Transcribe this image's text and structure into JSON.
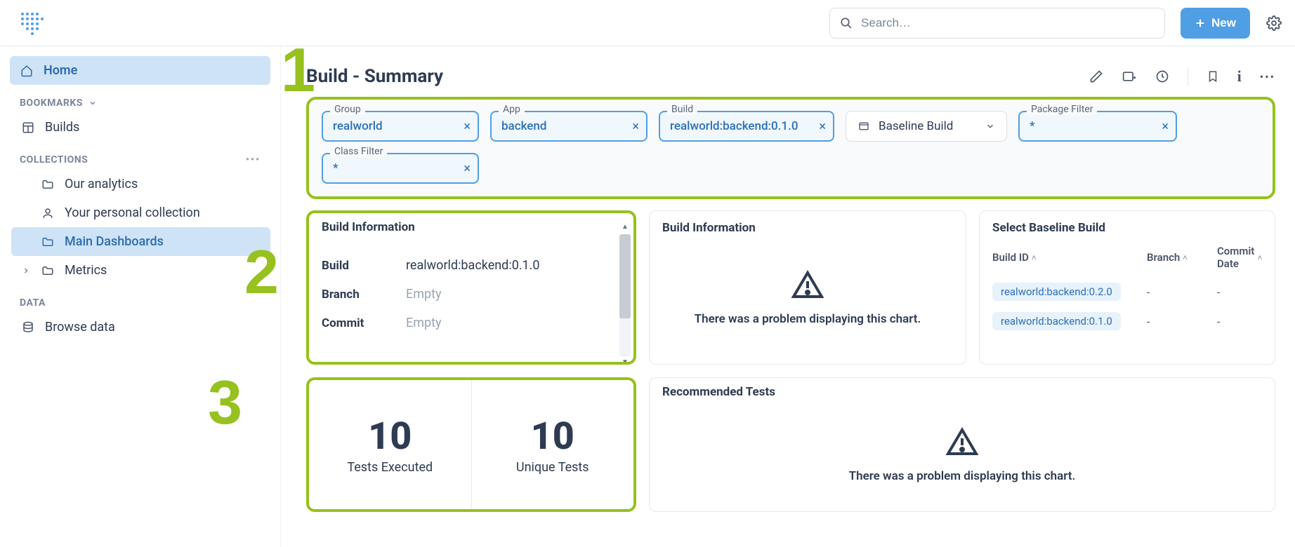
{
  "topbar": {
    "search_placeholder": "Search…",
    "new_label": "New"
  },
  "sidebar": {
    "home": "Home",
    "bookmarks_label": "BOOKMARKS",
    "bookmarks": [
      {
        "label": "Builds"
      }
    ],
    "collections_label": "COLLECTIONS",
    "collections": [
      {
        "label": "Our analytics"
      },
      {
        "label": "Your personal collection"
      },
      {
        "label": "Main Dashboards"
      },
      {
        "label": "Metrics"
      }
    ],
    "data_label": "DATA",
    "browse_data": "Browse data"
  },
  "page": {
    "title": "Build - Summary"
  },
  "filters": {
    "group": {
      "label": "Group",
      "value": "realworld"
    },
    "app": {
      "label": "App",
      "value": "backend"
    },
    "build": {
      "label": "Build",
      "value": "realworld:backend:0.1.0"
    },
    "baseline_dd": "Baseline Build",
    "package_filter": {
      "label": "Package Filter",
      "value": "*"
    },
    "class_filter": {
      "label": "Class Filter",
      "value": "*"
    }
  },
  "build_info": {
    "title": "Build Information",
    "rows": {
      "build_k": "Build",
      "build_v": "realworld:backend:0.1.0",
      "branch_k": "Branch",
      "branch_v": "Empty",
      "commit_k": "Commit",
      "commit_v": "Empty"
    }
  },
  "chart_error": {
    "title": "Build Information",
    "message": "There was a problem displaying this chart."
  },
  "baseline": {
    "title": "Select Baseline Build",
    "cols": {
      "id": "Build ID",
      "branch": "Branch",
      "commit": "Commit Date"
    },
    "rows": [
      {
        "id": "realworld:backend:0.2.0",
        "branch": "-",
        "commit": "-"
      },
      {
        "id": "realworld:backend:0.1.0",
        "branch": "-",
        "commit": "-"
      }
    ]
  },
  "stats": {
    "tests_executed_n": "10",
    "tests_executed_l": "Tests Executed",
    "unique_tests_n": "10",
    "unique_tests_l": "Unique Tests"
  },
  "recommended": {
    "title": "Recommended Tests",
    "message": "There was a problem displaying this chart."
  },
  "annotations": {
    "n1": "1",
    "n2": "2",
    "n3": "3"
  }
}
